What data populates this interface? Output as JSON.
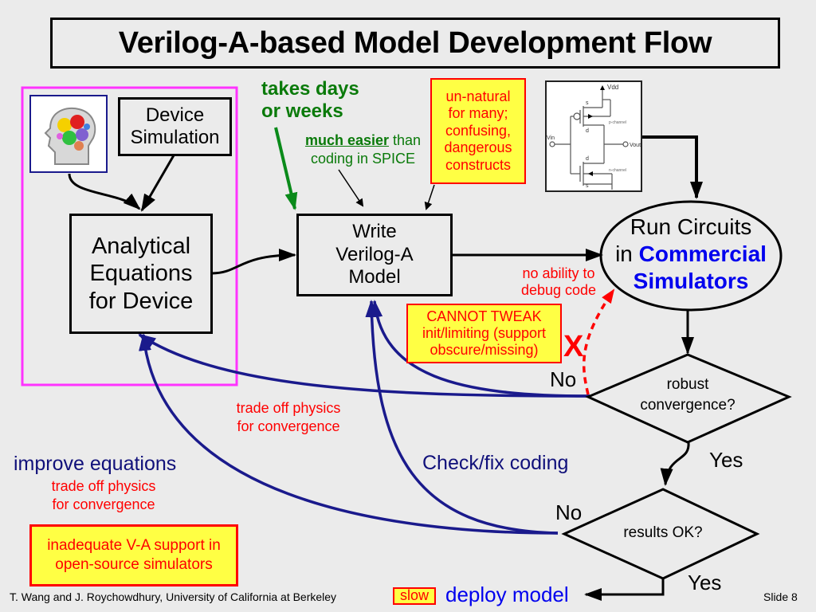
{
  "title": "Verilog-A-based Model Development Flow",
  "nodes": {
    "brain_image": "brain-gears-icon",
    "device_simulation": [
      "Device",
      "Simulation"
    ],
    "analytical_equations": [
      "Analytical",
      "Equations",
      "for Device"
    ],
    "write_model": [
      "Write",
      "Verilog-A",
      "Model"
    ],
    "circuit_image": {
      "labels": {
        "vdd": "Vdd",
        "vin": "Vin",
        "vout": "Vout",
        "p_channel": "p-channel",
        "n_channel": "n-channel",
        "s": "s",
        "d": "d"
      }
    },
    "run_circuits": {
      "line1": "Run Circuits",
      "line2_prefix": "in",
      "line2_highlight": "Commercial",
      "line3": "Simulators"
    },
    "robust_convergence": [
      "robust",
      "convergence?"
    ],
    "results_ok": "results OK?"
  },
  "annotations": {
    "takes_days": [
      "takes days",
      "or weeks"
    ],
    "much_easier": {
      "bold": "much easier",
      "rest": " than",
      "line2": "coding in SPICE"
    },
    "unnatural": [
      "un-natural",
      "for many;",
      "confusing,",
      "dangerous",
      "constructs"
    ],
    "no_debug": [
      "no ability to",
      "debug code"
    ],
    "cannot_tweak": [
      "CANNOT TWEAK",
      "init/limiting (support",
      "obscure/missing)"
    ],
    "x_mark": "X",
    "no_1": "No",
    "yes_1": "Yes",
    "no_2": "No",
    "yes_2": "Yes",
    "tradeoff_mid": [
      "trade off physics",
      "for convergence"
    ],
    "check_fix": "Check/fix coding",
    "improve_eq": "improve equations",
    "tradeoff_left": [
      "trade off physics",
      "for convergence"
    ],
    "inadequate": [
      "inadequate V-A support in",
      "open-source simulators"
    ],
    "slow": "slow",
    "deploy": "deploy model"
  },
  "footer": {
    "authors": "T. Wang and J. Roychowdhury, University of California at Berkeley",
    "slide": "Slide 8"
  },
  "colors": {
    "background": "#ebebeb",
    "magenta_frame": "#ff33ff",
    "feedback_arrow": "#1a1a8c",
    "note_fill": "#ffff44",
    "note_text": "#ff0000",
    "green": "#0a7a0a",
    "blue": "#0000ee"
  }
}
